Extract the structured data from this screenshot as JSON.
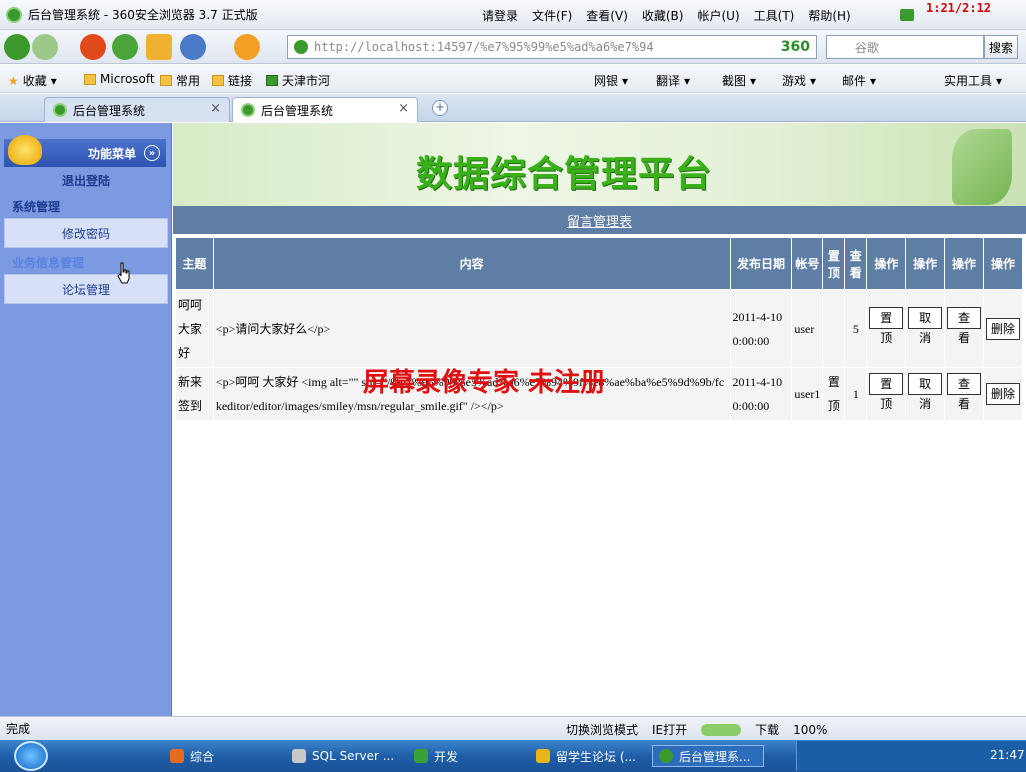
{
  "window": {
    "title": "后台管理系统 - 360安全浏览器 3.7 正式版",
    "login": "请登录",
    "menus": [
      "文件(F)",
      "查看(V)",
      "收藏(B)",
      "帐户(U)",
      "工具(T)",
      "帮助(H)"
    ],
    "clock": "1:21/2:12"
  },
  "nav": {
    "url": "http://localhost:14597/%e7%95%99%e5%ad%a6%e7%94",
    "engine": "360",
    "search_placeholder": "谷歌",
    "search_btn": "搜索"
  },
  "favbar": {
    "items": [
      "收藏",
      "Microsoft",
      "常用",
      "链接",
      "天津市河"
    ],
    "right": [
      "网银",
      "翻译",
      "截图",
      "游戏",
      "邮件",
      "实用工具"
    ]
  },
  "tabs": [
    {
      "label": "后台管理系统"
    },
    {
      "label": "后台管理系统"
    }
  ],
  "sidebar": {
    "header": "功能菜单",
    "logout": "退出登陆",
    "sections": [
      {
        "title": "系统管理",
        "items": [
          "修改密码"
        ]
      },
      {
        "title": "业务信息管理",
        "items": [
          "论坛管理"
        ]
      }
    ]
  },
  "content": {
    "banner_title": "数据综合管理平台",
    "caption": "留言管理表",
    "headers": [
      "主题",
      "内容",
      "发布日期",
      "帐号",
      "置顶",
      "查看",
      "操作",
      "操作",
      "操作",
      "操作"
    ],
    "rows": [
      {
        "subject": "呵呵大家好",
        "content": "<p>请问大家好么</p>",
        "date": "2011-4-10 0:00:00",
        "account": "user",
        "top": "",
        "views": "5",
        "btns": [
          "置顶",
          "取消",
          "查看",
          "删除"
        ]
      },
      {
        "subject": "新来签到",
        "content": "<p>呵呵  大家好  <img alt=\"\" src=\"/%e7%95%99%e5%ad%a6%e7%94%9f%e8%ae%ba%e5%9d%9b/fckeditor/editor/images/smiley/msn/regular_smile.gif\" /></p>",
        "date": "2011-4-10 0:00:00",
        "account": "user1",
        "top": "置顶",
        "views": "1",
        "btns": [
          "置顶",
          "取消",
          "查看",
          "删除"
        ]
      }
    ],
    "watermark": "屏幕录像专家  未注册"
  },
  "status": {
    "text": "完成",
    "right": [
      "切换浏览模式",
      "IE打开",
      "下载",
      "100%"
    ]
  },
  "taskbar": {
    "items": [
      "综合",
      "SQL Server ...",
      "开发",
      "留学生论坛 (...",
      "后台管理系..."
    ],
    "time": "21:47"
  }
}
